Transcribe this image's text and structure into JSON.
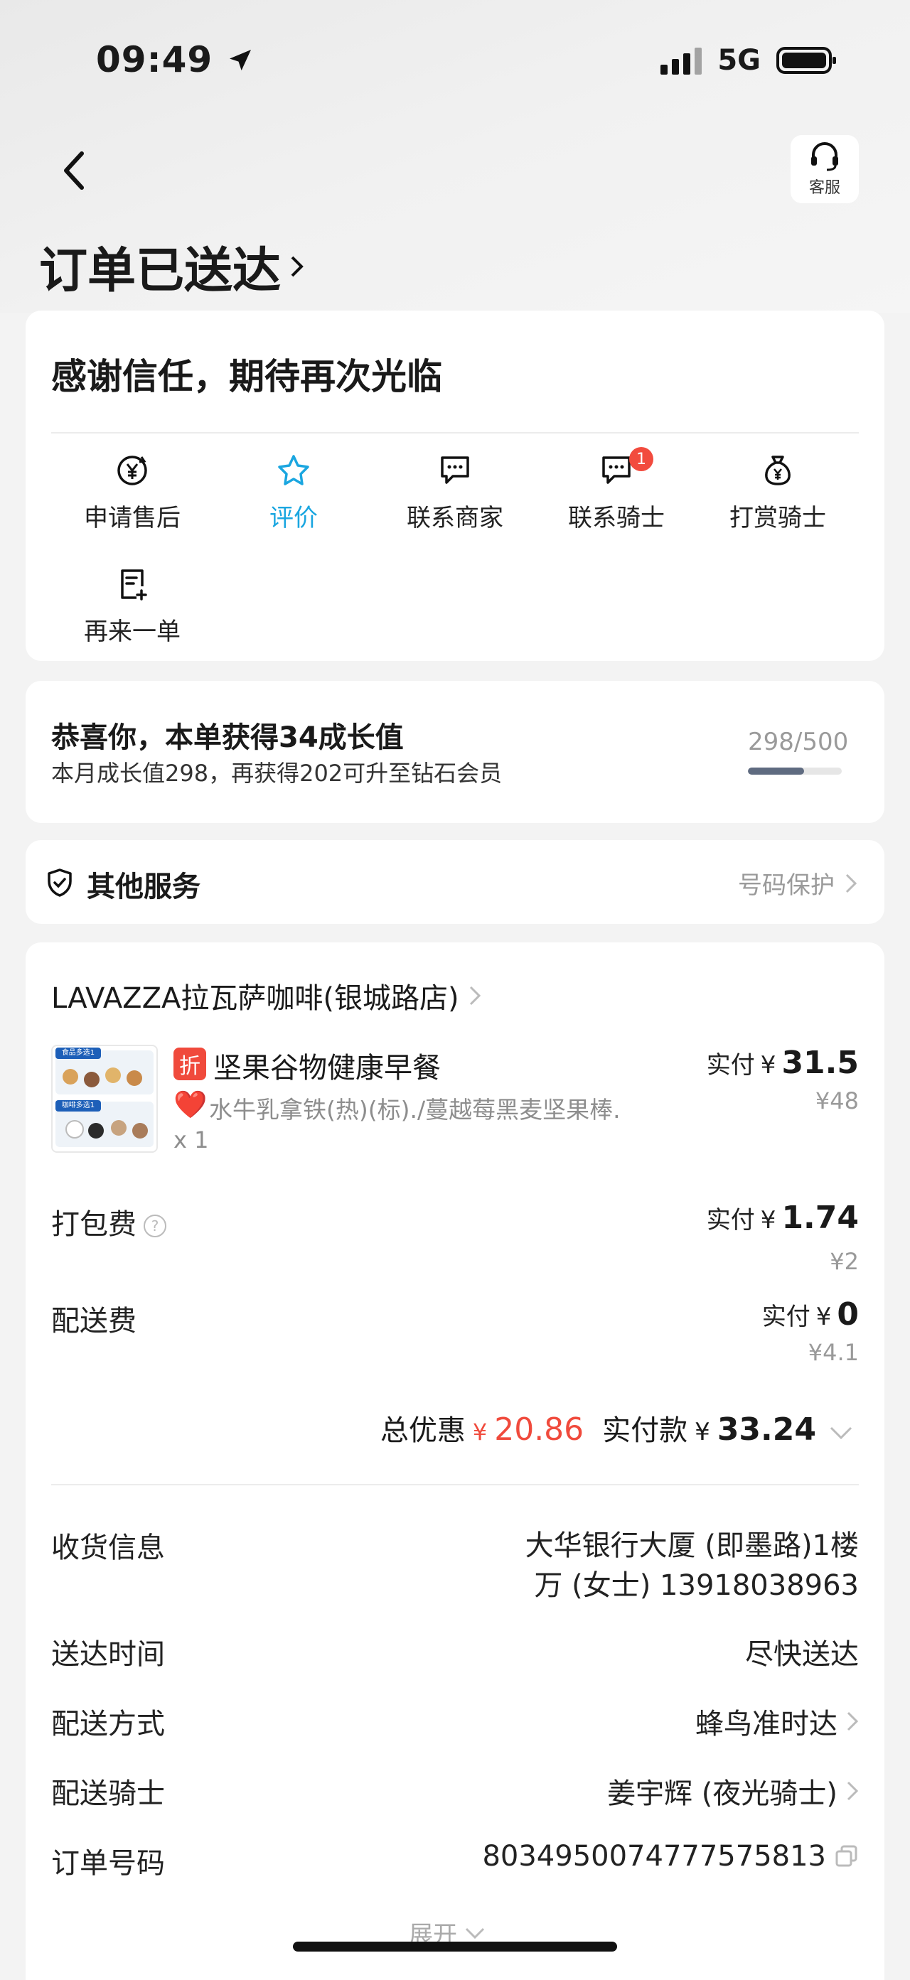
{
  "status_bar": {
    "time": "09:49",
    "network": "5G"
  },
  "header": {
    "service_label": "客服",
    "title": "订单已送达"
  },
  "status_card": {
    "message": "感谢信任，期待再次光临",
    "actions": [
      {
        "label": "申请售后",
        "icon": "refund-yen-icon"
      },
      {
        "label": "评价",
        "icon": "star-icon"
      },
      {
        "label": "联系商家",
        "icon": "chat-icon"
      },
      {
        "label": "联系骑士",
        "icon": "chat-icon",
        "badge": "1"
      },
      {
        "label": "打赏骑士",
        "icon": "money-bag-icon"
      },
      {
        "label": "再来一单",
        "icon": "reorder-icon"
      }
    ]
  },
  "growth": {
    "title": "恭喜你，本单获得34成长值",
    "subtitle": "本月成长值298，再获得202可升至钻石会员",
    "progress_text": "298/500",
    "progress_fraction": 0.596
  },
  "other_services": {
    "title": "其他服务",
    "right_label": "号码保护"
  },
  "order": {
    "shop_name": "LAVAZZA拉瓦萨咖啡(银城路店)",
    "item": {
      "discount_tag": "折",
      "name": "坚果谷物健康早餐",
      "heart": "❤️",
      "description": "水牛乳拿铁(热)(标)./蔓越莓黑麦坚果棒.",
      "quantity": "x 1",
      "paid_label": "实付",
      "currency": "¥",
      "paid": "31.5",
      "original": "¥48",
      "thumb_tag_1": "食品多选1",
      "thumb_tag_2": "咖啡多选1"
    },
    "packing_fee": {
      "label": "打包费",
      "help": "?",
      "paid_label": "实付",
      "currency": "¥",
      "paid": "1.74",
      "original": "¥2"
    },
    "delivery_fee": {
      "label": "配送费",
      "paid_label": "实付",
      "currency": "¥",
      "paid": "0",
      "original": "¥4.1"
    },
    "totals": {
      "discount_label": "总优惠",
      "currency": "¥",
      "discount": "20.86",
      "paid_label": "实付款",
      "paid": "33.24"
    }
  },
  "details": [
    {
      "label": "收货信息",
      "value": "大华银行大厦 (即墨路)1楼",
      "value2": "万 (女士) 13918038963"
    },
    {
      "label": "送达时间",
      "value": "尽快送达"
    },
    {
      "label": "配送方式",
      "value": "蜂鸟准时达"
    },
    {
      "label": "配送骑士",
      "value": "姜宇辉 (夜光骑士)"
    },
    {
      "label": "订单号码",
      "value": "8034950074777575813"
    }
  ],
  "expand_label": "展开",
  "colors": {
    "accent_blue": "#1aa6e0",
    "red": "#f04a3c",
    "background": "#f3f3f3"
  }
}
